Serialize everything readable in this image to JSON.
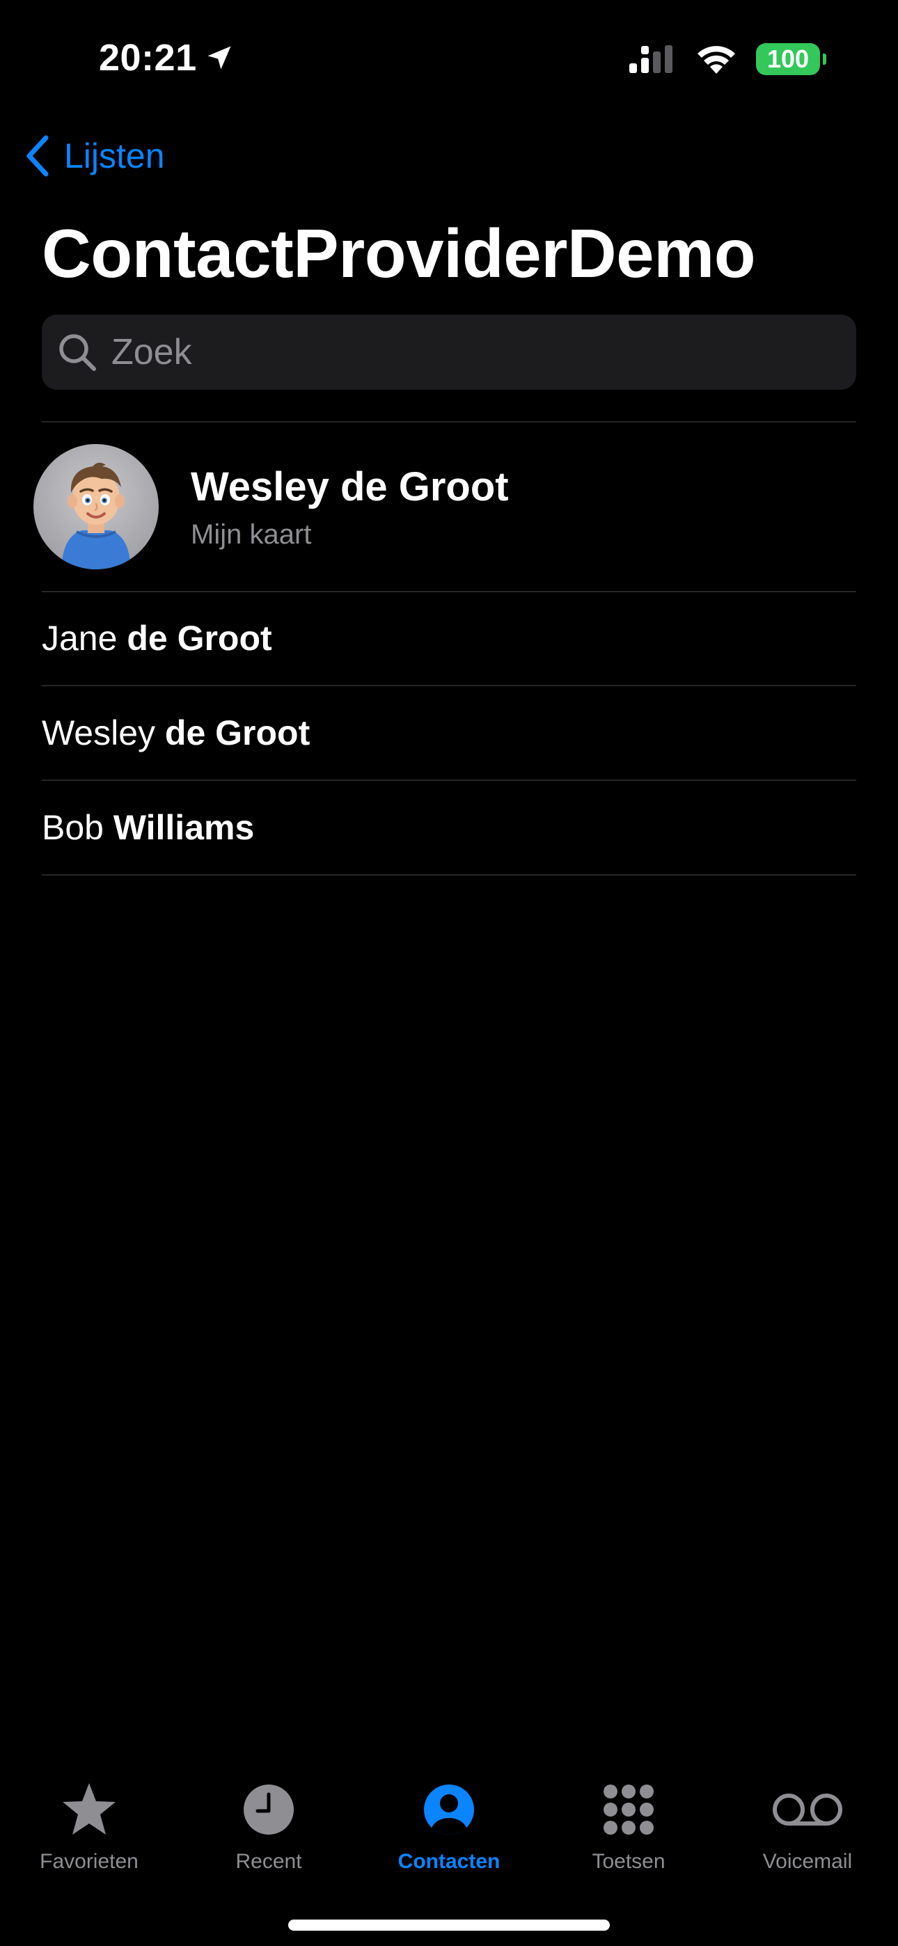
{
  "status_bar": {
    "time": "20:21",
    "battery": "100",
    "colors": {
      "battery": "#34c759"
    }
  },
  "nav": {
    "back_label": "Lijsten",
    "title": "ContactProviderDemo"
  },
  "search": {
    "placeholder": "Zoek",
    "value": ""
  },
  "my_card": {
    "name": "Wesley de Groot",
    "subtitle": "Mijn kaart"
  },
  "contacts": [
    {
      "first": "Jane",
      "last": "de Groot"
    },
    {
      "first": "Wesley",
      "last": "de Groot"
    },
    {
      "first": "Bob",
      "last": "Williams"
    }
  ],
  "tabs": [
    {
      "label": "Favorieten",
      "icon": "star-icon",
      "active": false
    },
    {
      "label": "Recent",
      "icon": "clock-icon",
      "active": false
    },
    {
      "label": "Contacten",
      "icon": "person-circle-icon",
      "active": true
    },
    {
      "label": "Toetsen",
      "icon": "keypad-icon",
      "active": false
    },
    {
      "label": "Voicemail",
      "icon": "voicemail-icon",
      "active": false
    }
  ],
  "colors": {
    "accent": "#0a84ff",
    "background": "#000000",
    "inactive": "#8e8e93",
    "search_field": "#1c1c1e"
  }
}
